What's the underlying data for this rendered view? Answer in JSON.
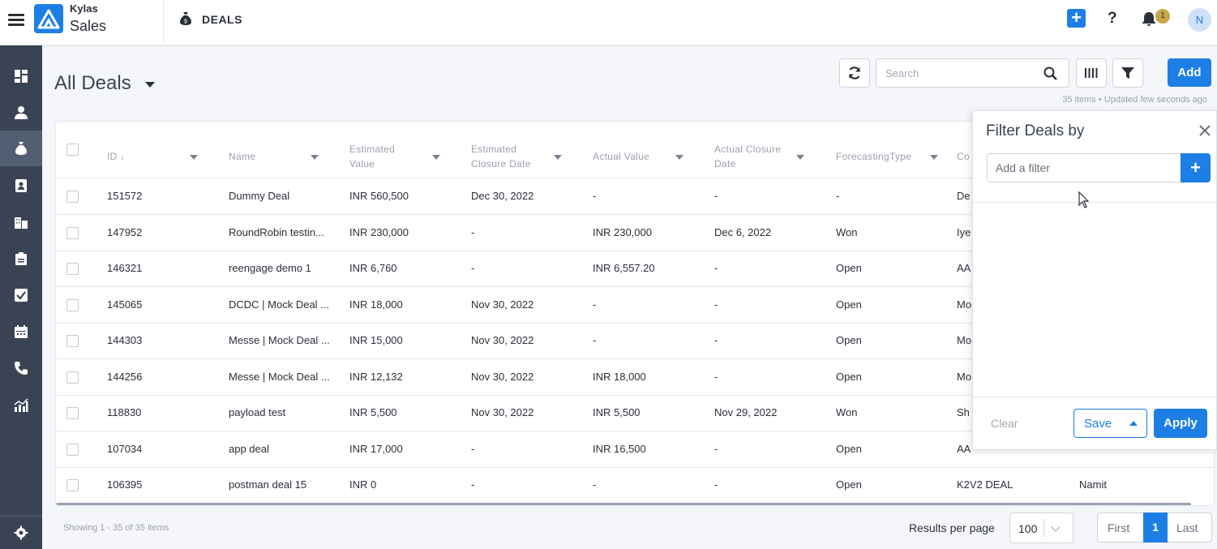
{
  "app": {
    "brand_top": "Kylas",
    "brand_sub": "Sales",
    "module": "DEALS",
    "notifications": "1",
    "avatar_initial": "N"
  },
  "page": {
    "title": "All Deals",
    "search_placeholder": "Search",
    "add_label": "Add",
    "meta": "35 items • Updated few seconds ago"
  },
  "sidebar": {
    "items": [
      "dashboard-icon",
      "leads-icon",
      "deals-icon",
      "contacts-icon",
      "companies-icon",
      "products-icon",
      "tasks-icon",
      "calendar-icon",
      "calls-icon",
      "reports-icon"
    ],
    "active": "deals-icon",
    "bottom": "settings-icon"
  },
  "table": {
    "columns": [
      "ID",
      "Name",
      "Estimated Value",
      "Estimated Closure Date",
      "Actual Value",
      "Actual Closure Date",
      "ForecastingType",
      "Co"
    ],
    "rows": [
      {
        "id": "151572",
        "name": "Dummy Deal",
        "est_value": "INR 560,500",
        "est_date": "Dec 30, 2022",
        "act_value": "-",
        "act_date": "-",
        "forecast": "-",
        "co": "De",
        "extra": ""
      },
      {
        "id": "147952",
        "name": "RoundRobin testin...",
        "est_value": "INR 230,000",
        "est_date": "-",
        "act_value": "INR 230,000",
        "act_date": "Dec 6, 2022",
        "forecast": "Won",
        "co": "Iye",
        "extra": ""
      },
      {
        "id": "146321",
        "name": "reengage demo 1",
        "est_value": "INR 6,760",
        "est_date": "-",
        "act_value": "INR 6,557.20",
        "act_date": "-",
        "forecast": "Open",
        "co": "AA",
        "extra": ""
      },
      {
        "id": "145065",
        "name": "DCDC | Mock Deal ...",
        "est_value": "INR 18,000",
        "est_date": "Nov 30, 2022",
        "act_value": "-",
        "act_date": "-",
        "forecast": "Open",
        "co": "Mo",
        "extra": ""
      },
      {
        "id": "144303",
        "name": "Messe | Mock Deal ...",
        "est_value": "INR 15,000",
        "est_date": "Nov 30, 2022",
        "act_value": "-",
        "act_date": "-",
        "forecast": "Open",
        "co": "Mo",
        "extra": ""
      },
      {
        "id": "144256",
        "name": "Messe | Mock Deal ...",
        "est_value": "INR 12,132",
        "est_date": "Nov 30, 2022",
        "act_value": "INR 18,000",
        "act_date": "-",
        "forecast": "Open",
        "co": "Mo",
        "extra": ""
      },
      {
        "id": "118830",
        "name": "payload test",
        "est_value": "INR 5,500",
        "est_date": "Nov 30, 2022",
        "act_value": "INR 5,500",
        "act_date": "Nov 29, 2022",
        "forecast": "Won",
        "co": "Sh",
        "extra": ""
      },
      {
        "id": "107034",
        "name": "app deal",
        "est_value": "INR 17,000",
        "est_date": "-",
        "act_value": "INR 16,500",
        "act_date": "-",
        "forecast": "Open",
        "co": "AA",
        "extra": ""
      },
      {
        "id": "106395",
        "name": "postman deal 15",
        "est_value": "INR 0",
        "est_date": "-",
        "act_value": "-",
        "act_date": "-",
        "forecast": "Open",
        "co": "K2V2 DEAL",
        "extra": "Namit"
      }
    ]
  },
  "footer": {
    "showing": "Showing 1 - 35 of 35 items",
    "rpp_label": "Results per page",
    "rpp_value": "100",
    "first": "First",
    "current": "1",
    "last": "Last"
  },
  "filter": {
    "title": "Filter Deals by",
    "placeholder": "Add a filter",
    "clear": "Clear",
    "save": "Save",
    "apply": "Apply"
  },
  "colors": {
    "accent": "#1d7fe6",
    "sidebar": "#3a4354",
    "sidebar_active": "#545e72"
  }
}
